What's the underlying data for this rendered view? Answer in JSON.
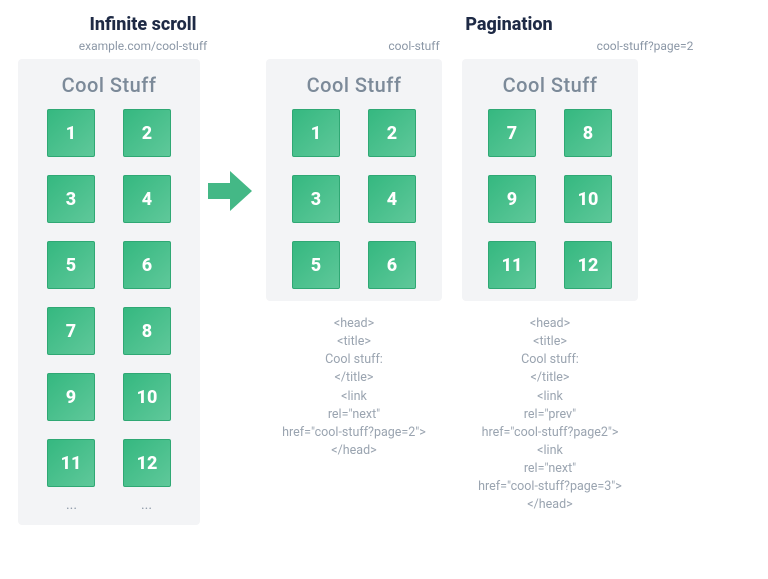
{
  "headings": {
    "left": "Infinite scroll",
    "right": "Pagination"
  },
  "urls": {
    "infinite": "example.com/cool-stuff",
    "page1": "cool-stuff",
    "page2": "cool-stuff?page=2"
  },
  "card_title": "Cool Stuff",
  "infinite_items": [
    "1",
    "2",
    "3",
    "4",
    "5",
    "6",
    "7",
    "8",
    "9",
    "10",
    "11",
    "12"
  ],
  "ellipsis": "...",
  "page1_items": [
    "1",
    "2",
    "3",
    "4",
    "5",
    "6"
  ],
  "page2_items": [
    "7",
    "8",
    "9",
    "10",
    "11",
    "12"
  ],
  "code1": "<head>\n<title>\nCool stuff:\n</title>\n<link\nrel=\"next\"\nhref=\"cool-stuff?page=2\">\n</head>",
  "code2": "<head>\n<title>\nCool stuff:\n</title>\n<link\nrel=\"prev\"\nhref=\"cool-stuff?page2\">\n<link\nrel=\"next\"\nhref=\"cool-stuff?page=3\">\n</head>"
}
